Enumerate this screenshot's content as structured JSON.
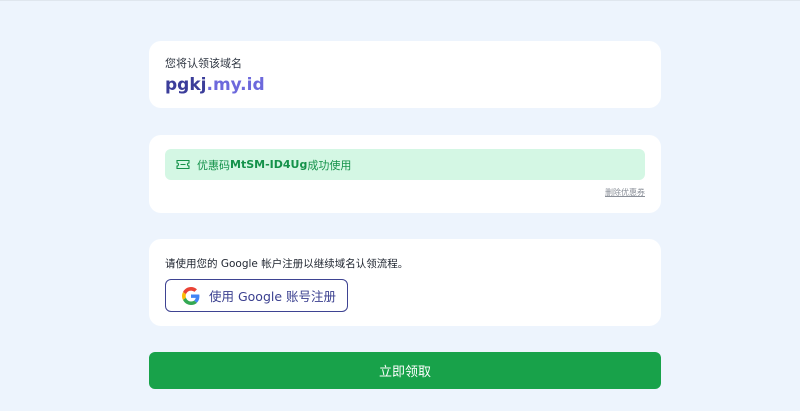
{
  "domain_card": {
    "label": "您将认领该域名",
    "domain_base": "pgkj",
    "domain_suffix": ".my.id"
  },
  "coupon_card": {
    "prefix": "优惠码",
    "code": "MtSM-ID4Ug",
    "suffix": "成功使用",
    "remove_label": "删除优惠券",
    "icon": "ticket-icon"
  },
  "google_card": {
    "description": "请使用您的 Google 帐户注册以继续域名认领流程。",
    "button_label": "使用 Google 账号注册",
    "icon": "google-icon"
  },
  "claim_button": {
    "label": "立即领取"
  },
  "colors": {
    "accent_green": "#18a24a",
    "coupon_bg": "#d4f7e4",
    "domain_base": "#3b3d9a",
    "domain_suffix": "#6d69dc"
  }
}
